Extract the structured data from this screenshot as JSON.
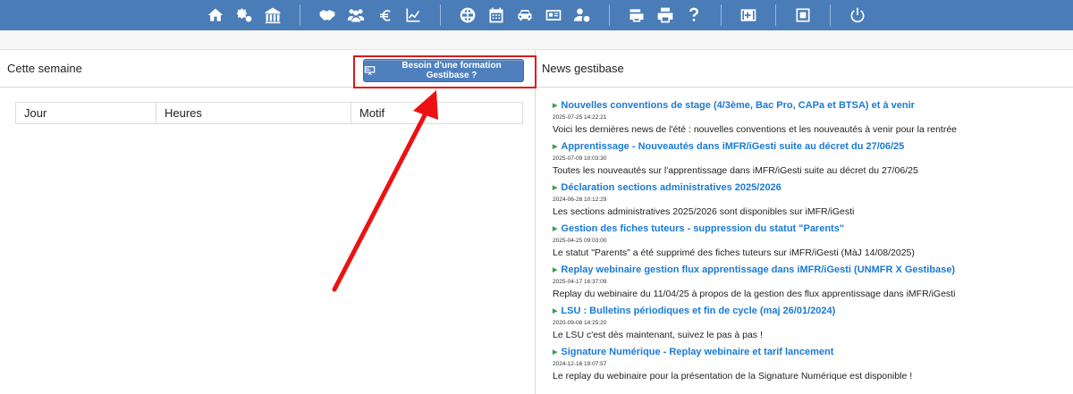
{
  "toolbar": {
    "groups": [
      [
        "home-icon",
        "settings-icon",
        "school-icon"
      ],
      [
        "handshake-icon",
        "users-icon",
        "euro-icon",
        "chart-icon"
      ],
      [
        "globe-icon",
        "calendar-icon",
        "car-icon",
        "id-card-icon",
        "user-settings-icon"
      ],
      [
        "printer-stack-icon",
        "printer-icon",
        "help-icon"
      ],
      [
        "first-aid-icon"
      ],
      [
        "window-icon"
      ],
      [
        "power-icon"
      ]
    ],
    "color": "#4a7cb8"
  },
  "left": {
    "title": "Cette semaine",
    "formation_button": "Besoin d'une formation Gestibase ?",
    "table": {
      "columns": [
        "Jour",
        "Heures",
        "Motif"
      ]
    }
  },
  "right": {
    "title": "News gestibase",
    "news": [
      {
        "title": "Nouvelles conventions de stage (4/3ème, Bac Pro, CAPa et BTSA) et à venir",
        "date": "2025-07-25 14:22:21",
        "desc": "Voici les dernières news de l'été : nouvelles conventions et les nouveautés à venir pour la rentrée"
      },
      {
        "title": "Apprentissage - Nouveautés dans iMFR/iGesti suite au décret du 27/06/25",
        "date": "2025-07-09 10:03:30",
        "desc": "Toutes les nouveautés sur l'apprentissage dans iMFR/iGesti suite au décret du 27/06/25"
      },
      {
        "title": "Déclaration sections administratives 2025/2026",
        "date": "2024-06-28 10:12:29",
        "desc": "Les sections administratives 2025/2026 sont disponibles sur iMFR/iGesti"
      },
      {
        "title": "Gestion des fiches tuteurs - suppression du statut \"Parents\"",
        "date": "2025-04-25 09:03:00",
        "desc": "Le statut \"Parents\" a été supprimé des fiches tuteurs sur iMFR/iGesti (MàJ 14/08/2025)"
      },
      {
        "title": "Replay webinaire gestion flux apprentissage dans iMFR/iGesti (UNMFR X Gestibase)",
        "date": "2025-04-17 16:37:09",
        "desc": "Replay du webinaire du 11/04/25 à propos de la gestion des flux apprentissage dans iMFR/iGesti"
      },
      {
        "title": "LSU : Bulletins périodiques et fin de cycle (maj 26/01/2024)",
        "date": "2020-09-08 14:25:20",
        "desc": "Le LSU c'est dès maintenant, suivez le pas à pas !"
      },
      {
        "title": "Signature Numérique - Replay webinaire et tarif lancement",
        "date": "2024-12-16 19:07:57",
        "desc": "Le replay du webinaire pour la présentation de la Signature Numérique est disponible !"
      }
    ]
  }
}
